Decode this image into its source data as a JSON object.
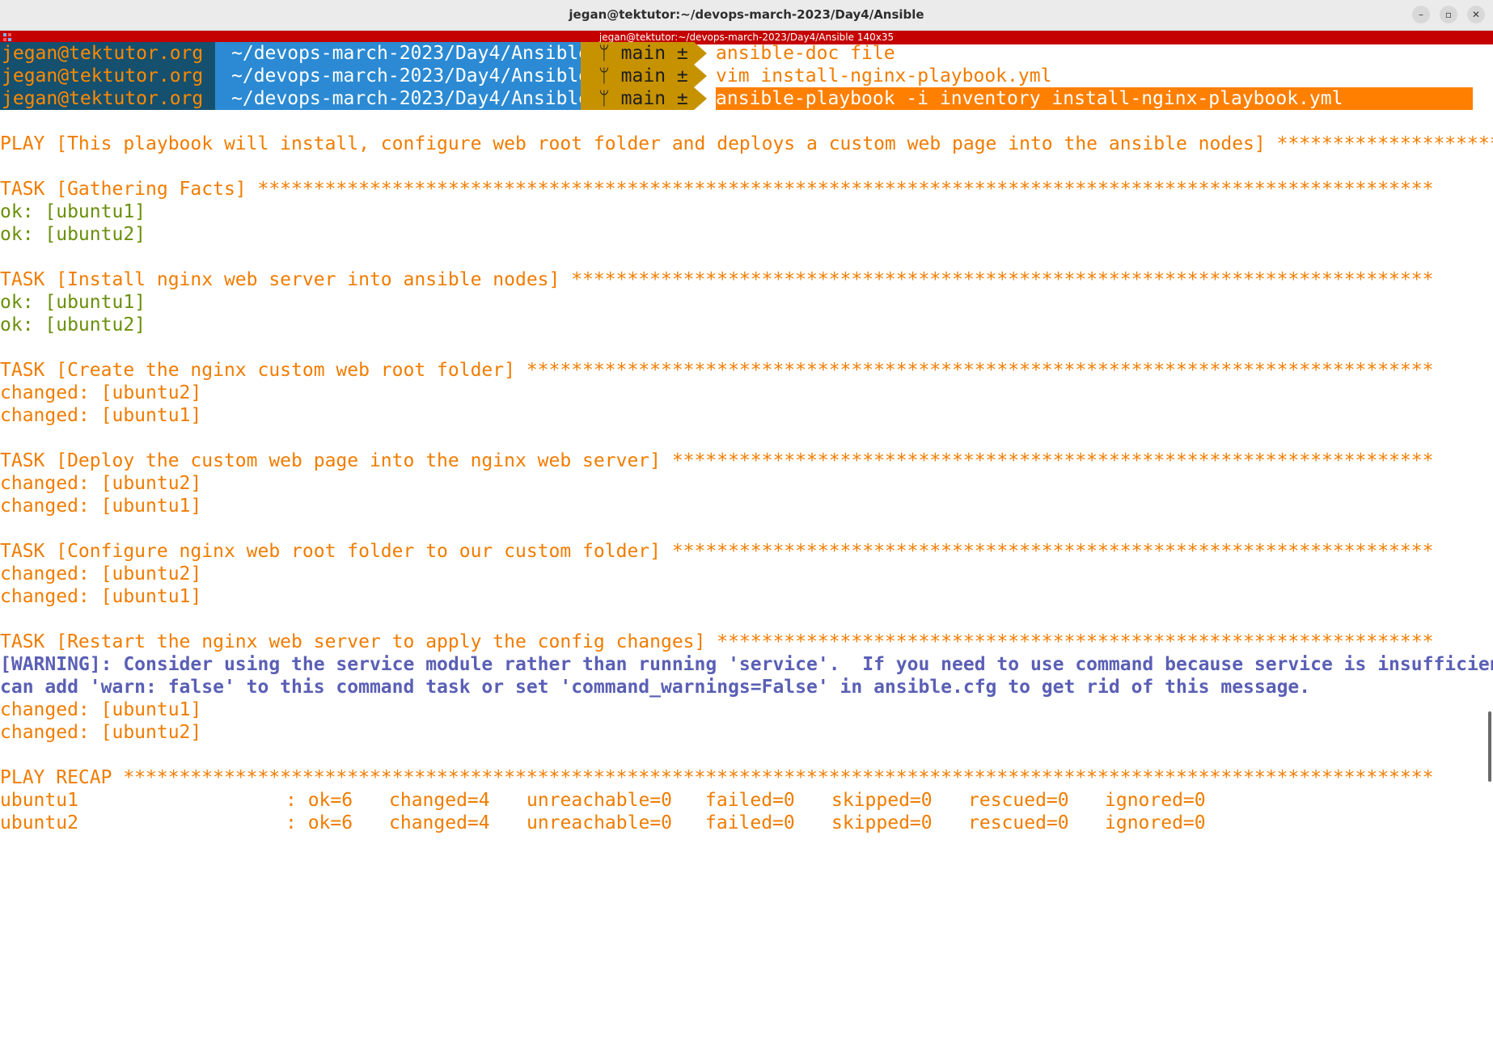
{
  "window": {
    "title": "jegan@tektutor:~/devops-march-2023/Day4/Ansible",
    "minimize": "–",
    "restore": "▫",
    "close": "✕"
  },
  "tmux": {
    "status": "jegan@tektutor:~/devops-march-2023/Day4/Ansible 140x35"
  },
  "prompt": {
    "user": "jegan@tektutor.org",
    "path": "~/devops-march-2023/Day4/Ansible",
    "git": "main ±",
    "branch_icon": "git-branch-icon"
  },
  "commands": [
    "ansible-doc file",
    "vim install-nginx-playbook.yml",
    "ansible-playbook -i inventory install-nginx-playbook.yml"
  ],
  "output": {
    "play": "PLAY [This playbook will install, configure web root folder and deploys a custom web page into the ansible nodes] *************************",
    "task1": "TASK [Gathering Facts] *********************************************************************************************************",
    "task1_r1": "ok: [ubuntu1]",
    "task1_r2": "ok: [ubuntu2]",
    "task2": "TASK [Install nginx web server into ansible nodes] *****************************************************************************",
    "task2_r1": "ok: [ubuntu1]",
    "task2_r2": "ok: [ubuntu2]",
    "task3": "TASK [Create the nginx custom web root folder] *********************************************************************************",
    "task3_r1": "changed: [ubuntu2]",
    "task3_r2": "changed: [ubuntu1]",
    "task4": "TASK [Deploy the custom web page into the nginx web server] ********************************************************************",
    "task4_r1": "changed: [ubuntu2]",
    "task4_r2": "changed: [ubuntu1]",
    "task5": "TASK [Configure nginx web root folder to our custom folder] ********************************************************************",
    "task5_r1": "changed: [ubuntu2]",
    "task5_r2": "changed: [ubuntu1]",
    "task6": "TASK [Restart the nginx web server to apply the config changes] ****************************************************************",
    "warning_1": "[WARNING]: Consider using the service module rather than running 'service'.  If you need to use command because service is insufficient you",
    "warning_2": "can add 'warn: false' to this command task or set 'command_warnings=False' in ansible.cfg to get rid of this message.",
    "task6_r1": "changed: [ubuntu1]",
    "task6_r2": "changed: [ubuntu2]",
    "recap": "PLAY RECAP *********************************************************************************************************************"
  },
  "recap_rows": [
    {
      "host": "ubuntu1",
      "ok": ": ok=6",
      "changed": "changed=4",
      "unreachable": "unreachable=0",
      "failed": "failed=0",
      "skipped": "skipped=0",
      "rescued": "rescued=0",
      "ignored": "ignored=0"
    },
    {
      "host": "ubuntu2",
      "ok": ": ok=6",
      "changed": "changed=4",
      "unreachable": "unreachable=0",
      "failed": "failed=0",
      "skipped": "skipped=0",
      "rescued": "rescued=0",
      "ignored": "ignored=0"
    }
  ],
  "colors": {
    "orange": "#f07c00",
    "green": "#6a8f0a",
    "warning_blue": "#5a5fb5",
    "tmux_red": "#c40000"
  }
}
